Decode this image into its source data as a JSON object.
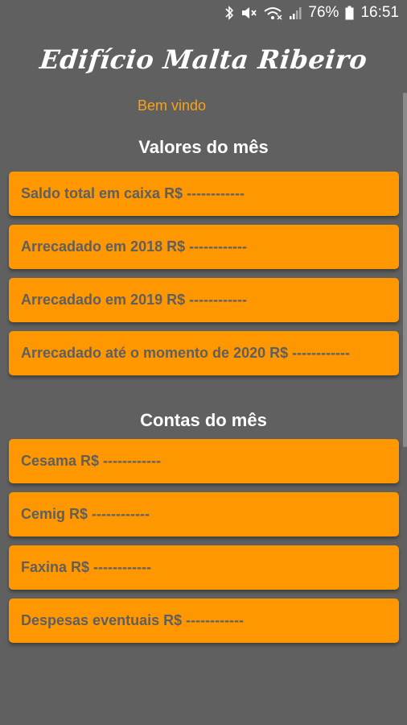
{
  "status_bar": {
    "battery_percent": "76%",
    "time": "16:51",
    "icons": [
      "bluetooth-icon",
      "mute-icon",
      "wifi-icon",
      "signal-icon",
      "battery-icon"
    ]
  },
  "app": {
    "title": "Edifício Malta Ribeiro",
    "welcome": "Bem vindo"
  },
  "valores": {
    "title": "Valores do mês",
    "items": [
      {
        "label": "Saldo total em caixa R$ ------------"
      },
      {
        "label": "Arrecadado em 2018 R$ ------------"
      },
      {
        "label": "Arrecadado em 2019 R$ ------------"
      },
      {
        "label": "Arrecadado até o momento de 2020 R$ ------------"
      }
    ]
  },
  "contas": {
    "title": "Contas do mês",
    "items": [
      {
        "label": "Cesama R$ ------------"
      },
      {
        "label": "Cemig R$ ------------"
      },
      {
        "label": "Faxina R$ ------------"
      },
      {
        "label": "Despesas eventuais R$ ------------"
      }
    ]
  },
  "colors": {
    "background": "#606060",
    "card": "#ff9700",
    "card_text": "#5f5f5f",
    "welcome_text": "#f7a21b"
  }
}
